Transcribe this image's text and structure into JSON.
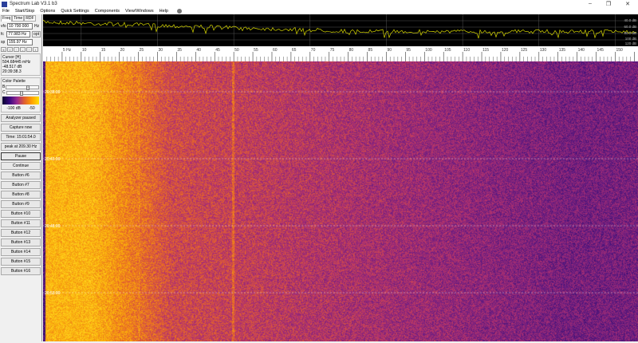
{
  "window": {
    "title": "Spectrum Lab V3.1 b3",
    "minimize": "–",
    "restore": "❐",
    "close": "✕"
  },
  "menu": [
    "File",
    "Start/Stop",
    "Options",
    "Quick Settings",
    "Components",
    "View/Windows",
    "Help"
  ],
  "left": {
    "tabs": [
      "Freq",
      "Time",
      "RDF"
    ],
    "vfo": {
      "label": "vfo",
      "value": "10 700 000",
      "unit": "Hz"
    },
    "fc": {
      "label": "fc",
      "value": "77.983 Hz",
      "button": "opt"
    },
    "sp": {
      "label": "sp",
      "value": "155.97 Hz"
    },
    "small_buttons": [
      "«",
      "‹",
      "·",
      "-",
      "·",
      "›"
    ],
    "cursor": {
      "title": "Cursor [H]",
      "freq": "504.68445 mHz",
      "level": "-48.517 dB",
      "time": "20:39:38.3"
    },
    "palette": {
      "title": "Color Palette",
      "b": "B",
      "c": "C",
      "min": "-100 dB",
      "max": "-50",
      "b_level": 0.7,
      "c_level": 0.45
    },
    "buttons": [
      "Analyzer paused",
      "Capture now",
      "Time:  15:01:54.0",
      "peak at 209.30 Hz",
      "Pause",
      "Continue",
      "Button #6",
      "Button #7",
      "Button #8",
      "Button #9",
      "Button #10",
      "Button #11",
      "Button #12",
      "Button #13",
      "Button #14",
      "Button #15",
      "Button #16"
    ]
  },
  "spectrum": {
    "db_labels": [
      "40.0 dB",
      "60.0 dB",
      "80.0 dB",
      "100 dB",
      "120 dB"
    ],
    "trace_color": "#d8d800"
  },
  "ruler": {
    "unit": "Hz",
    "ticks": [
      5,
      10,
      15,
      20,
      25,
      30,
      35,
      40,
      45,
      50,
      55,
      60,
      65,
      70,
      75,
      80,
      85,
      90,
      95,
      100,
      105,
      110,
      115,
      120,
      125,
      130,
      135,
      140,
      145,
      150
    ],
    "max_hz": 155.97
  },
  "waterfall": {
    "time_labels": [
      "20:38:00",
      "20:43:00",
      "20:48:00",
      "20:53:00"
    ]
  }
}
